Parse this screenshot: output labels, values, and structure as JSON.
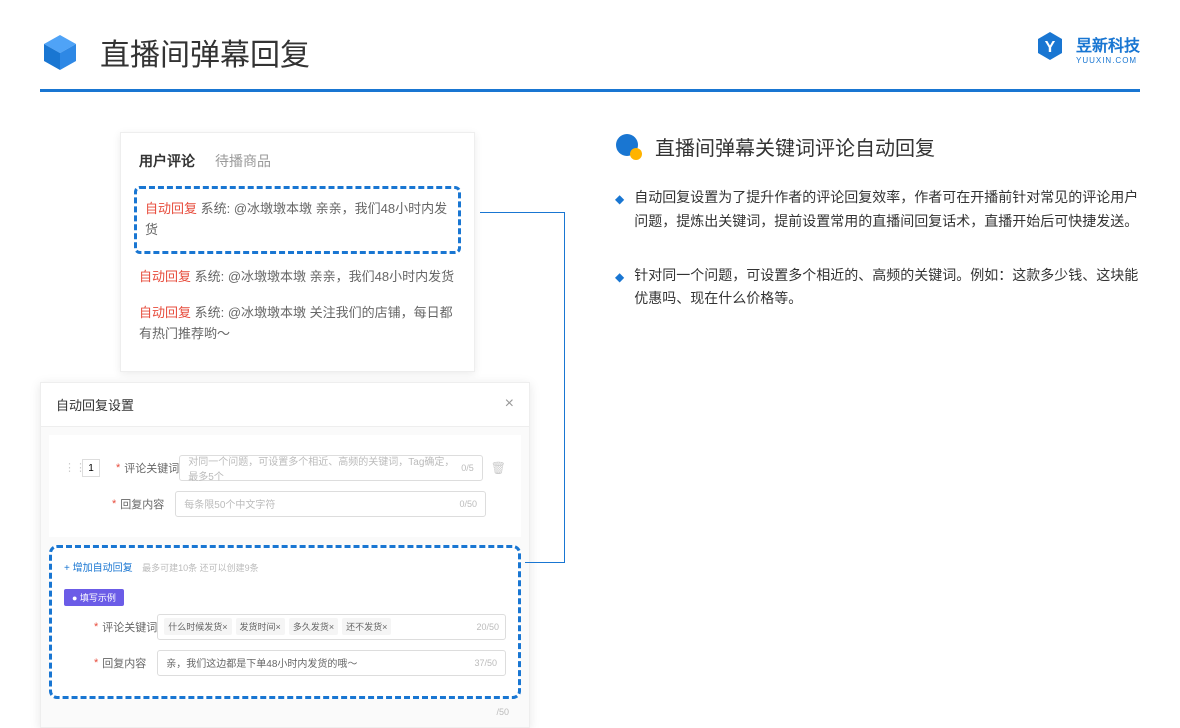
{
  "header": {
    "title": "直播间弹幕回复",
    "brand_name": "昱新科技",
    "brand_sub": "YUUXIN.COM"
  },
  "comments": {
    "tab_active": "用户评论",
    "tab_inactive": "待播商品",
    "rows": [
      {
        "tag": "自动回复",
        "text": " 系统: @冰墩墩本墩 亲亲，我们48小时内发货"
      },
      {
        "tag": "自动回复",
        "text": " 系统: @冰墩墩本墩 亲亲，我们48小时内发货"
      },
      {
        "tag": "自动回复",
        "text": " 系统: @冰墩墩本墩 关注我们的店铺，每日都有热门推荐哟～"
      }
    ]
  },
  "settings": {
    "title": "自动回复设置",
    "row_num": "1",
    "label_keyword": "评论关键词",
    "placeholder_keyword": "对同一个问题，可设置多个相近、高频的关键词，Tag确定，最多5个",
    "count_keyword": "0/5",
    "label_content": "回复内容",
    "placeholder_content": "每条限50个中文字符",
    "count_content": "0/50",
    "add_link": "+ 增加自动回复",
    "hint": "最多可建10条 还可以创建9条",
    "example_badge": "● 填写示例",
    "example_tags": [
      "什么时候发货×",
      "发货时间×",
      "多久发货×",
      "还不发货×"
    ],
    "example_tag_count": "20/50",
    "example_content": "亲，我们这边都是下单48小时内发货的哦～",
    "example_content_count": "37/50",
    "outer_count": "/50"
  },
  "right": {
    "section_title": "直播间弹幕关键词评论自动回复",
    "bullets": [
      "自动回复设置为了提升作者的评论回复效率，作者可在开播前针对常见的评论用户问题，提炼出关键词，提前设置常用的直播间回复话术，直播开始后可快捷发送。",
      "针对同一个问题，可设置多个相近的、高频的关键词。例如：这款多少钱、这块能优惠吗、现在什么价格等。"
    ]
  }
}
